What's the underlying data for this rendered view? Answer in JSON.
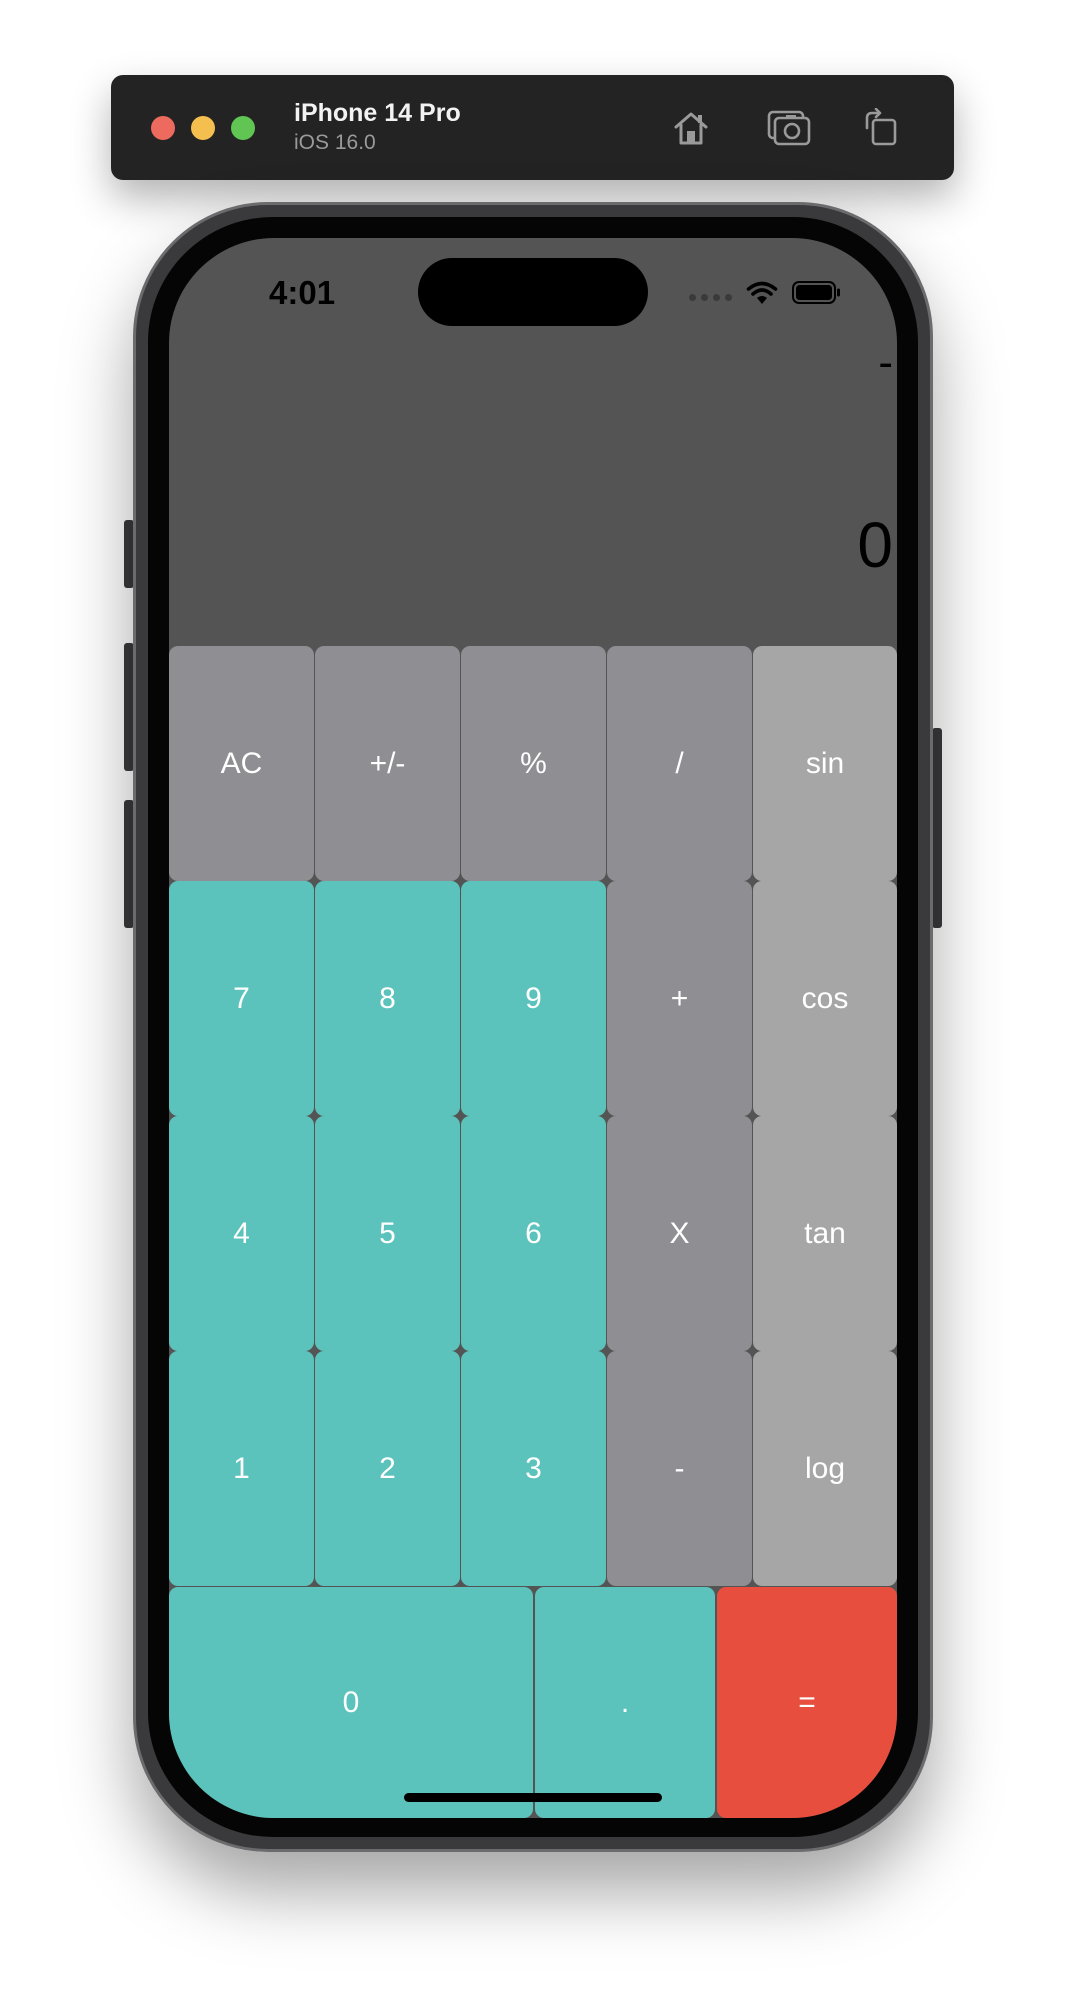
{
  "simulator": {
    "device_name": "iPhone 14 Pro",
    "os_version": "iOS 16.0",
    "toolbar_icons": [
      "home-icon",
      "screenshot-icon",
      "rotate-icon"
    ]
  },
  "status_bar": {
    "time": "4:01",
    "icons": [
      "cellular-signal-icon",
      "wifi-icon",
      "battery-icon"
    ]
  },
  "display": {
    "expression": "-",
    "value": "0"
  },
  "keypad": {
    "row1": [
      "AC",
      "+/-",
      "%",
      "/",
      "sin"
    ],
    "row2": [
      "7",
      "8",
      "9",
      "+",
      "cos"
    ],
    "row3": [
      "4",
      "5",
      "6",
      "X",
      "tan"
    ],
    "row4": [
      "1",
      "2",
      "3",
      "-",
      "log"
    ],
    "row5": [
      "0",
      ".",
      "="
    ]
  },
  "colors": {
    "screen_background": "#545454",
    "function_key": "#8e8e93",
    "scientific_key": "#a6a6a6",
    "digit_key": "#5bc3bb",
    "equals_key": "#e74e3d"
  }
}
